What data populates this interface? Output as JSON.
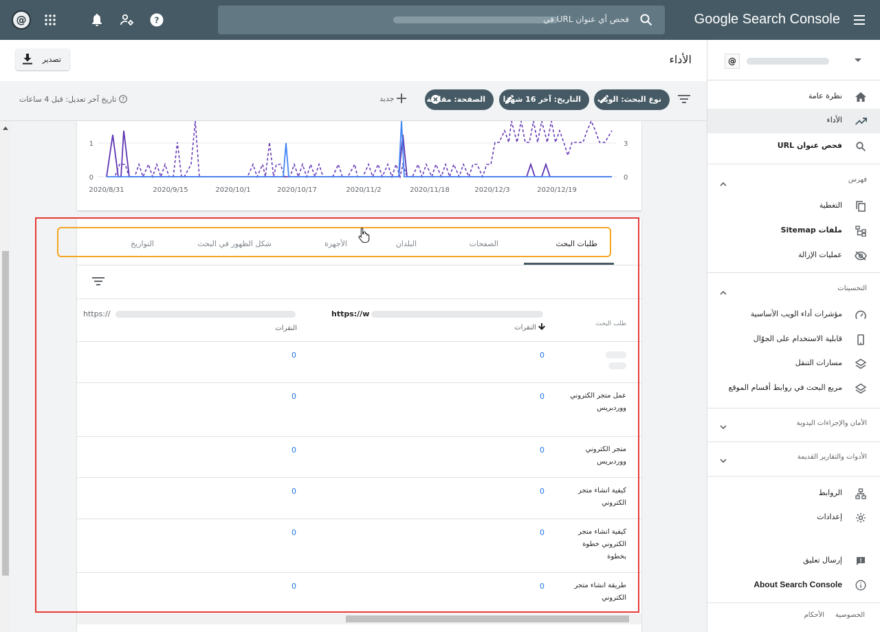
{
  "topbar": {
    "avatar_text": "@",
    "search_placeholder": "فحص أي عنوان URL في",
    "brand": "Google Search Console"
  },
  "header": {
    "title": "الأداء",
    "export_label": "تصدير"
  },
  "filters": {
    "chips": [
      {
        "label": "نوع البحث: الويب"
      },
      {
        "label": "التاريخ: آخر 16 شهرًا"
      },
      {
        "label": "الصفحة: مقارنة"
      }
    ],
    "new_label": "جديد",
    "last_updated": "تاريخ آخر تعديل: قبل 4 ساعات"
  },
  "chart_data": {
    "type": "line",
    "x_ticks": [
      "2020/8/31",
      "2020/9/15",
      "2020/10/1",
      "2020/10/17",
      "2020/11/2",
      "2020/11/18",
      "2020/12/3",
      "2020/12/19"
    ],
    "y_left_ticks": [
      "0",
      "1"
    ],
    "y_right_ticks": [
      "0",
      "3"
    ],
    "series": [
      {
        "values": [
          0,
          0,
          1,
          0,
          0,
          1,
          0,
          0,
          0,
          0,
          0,
          0,
          0,
          0,
          0,
          0,
          0,
          0,
          0,
          0,
          0,
          0,
          0,
          0,
          0,
          0,
          0,
          0,
          0,
          0,
          0,
          0,
          0,
          0,
          0,
          0,
          0,
          0,
          0,
          0,
          0,
          0,
          0,
          0,
          0,
          0,
          0,
          0,
          0,
          0,
          0,
          0,
          0,
          0,
          0,
          0,
          0,
          0,
          0,
          0,
          0,
          0,
          0,
          0,
          0,
          0,
          0,
          0,
          0,
          0,
          0,
          0,
          0,
          0,
          0,
          0,
          0,
          0,
          0,
          0,
          0,
          0,
          0,
          0,
          0,
          0,
          0,
          0,
          0,
          0,
          0,
          0,
          0,
          0,
          0,
          0,
          0,
          0,
          0,
          0,
          0,
          0,
          0,
          0,
          0,
          0,
          0,
          0,
          0,
          0,
          0,
          0,
          0,
          0,
          0,
          0,
          0,
          0,
          0,
          0,
          0,
          0,
          0,
          0,
          0,
          0
        ]
      },
      {
        "values": [
          0
        ]
      },
      {
        "values": [
          0
        ]
      }
    ],
    "colors": {
      "series_a": "#5e35b1",
      "series_b": "#673ab7",
      "series_c": "#4285f4"
    }
  },
  "tabs": [
    {
      "label": "طلبات البحث",
      "active": true
    },
    {
      "label": "الصفحات"
    },
    {
      "label": "البلدان"
    },
    {
      "label": "الأجهزة"
    },
    {
      "label": "شكل الظهور في البحث"
    },
    {
      "label": "التواريخ"
    }
  ],
  "table": {
    "col_query": "طلب البحث",
    "col1_url": "https://w",
    "col2_url": "https://",
    "col_clicks": "النقرات",
    "rows": [
      {
        "query": "",
        "clicks1": "0",
        "clicks2": "0"
      },
      {
        "query": "عمل متجر الكتروني ووردبريس",
        "clicks1": "0",
        "clicks2": "0"
      },
      {
        "query": "متجر الكتروني ووردبريس",
        "clicks1": "0",
        "clicks2": "0"
      },
      {
        "query": "كيفية انشاء متجر الكتروني",
        "clicks1": "0",
        "clicks2": "0"
      },
      {
        "query": "كيفية انشاء متجر الكتروني خطوة بخطوة",
        "clicks1": "0",
        "clicks2": "0"
      },
      {
        "query": "طريقة انشاء متجر الكتروني",
        "clicks1": "0",
        "clicks2": "0"
      }
    ]
  },
  "sidebar": {
    "items": [
      {
        "label": "نظرة عامة",
        "icon": "home-icon"
      },
      {
        "label": "الأداء",
        "icon": "trending-up-icon",
        "active": true
      },
      {
        "label": "فحص عنوان URL",
        "icon": "search-icon"
      }
    ],
    "index_heading": "فهرس",
    "index_items": [
      {
        "label": "التغطية",
        "icon": "copy-icon"
      },
      {
        "label": "ملفات Sitemap",
        "icon": "sitemap-icon"
      },
      {
        "label": "عمليات الإزالة",
        "icon": "eye-off-icon"
      }
    ],
    "enh_heading": "التحسينات",
    "enh_items": [
      {
        "label": "مؤشرات أداء الويب الأساسية",
        "icon": "speed-icon"
      },
      {
        "label": "قابلية الاستخدام على الجوّال",
        "icon": "phone-icon"
      },
      {
        "label": "مسارات التنقل",
        "icon": "layers-icon"
      },
      {
        "label": "مربع البحث في روابط أقسام الموقع",
        "icon": "layers-icon"
      }
    ],
    "security_heading": "الأمان والإجراءات اليدوية",
    "legacy_heading": "الأدوات والتقارير القديمة",
    "bottom_items": [
      {
        "label": "الروابط",
        "icon": "links-icon"
      },
      {
        "label": "إعدادات",
        "icon": "gear-icon"
      }
    ],
    "feedback": "إرسال تعليق",
    "about": "About Search Console",
    "footer": {
      "privacy": "الخصوصية",
      "terms": "الأحكام"
    }
  }
}
